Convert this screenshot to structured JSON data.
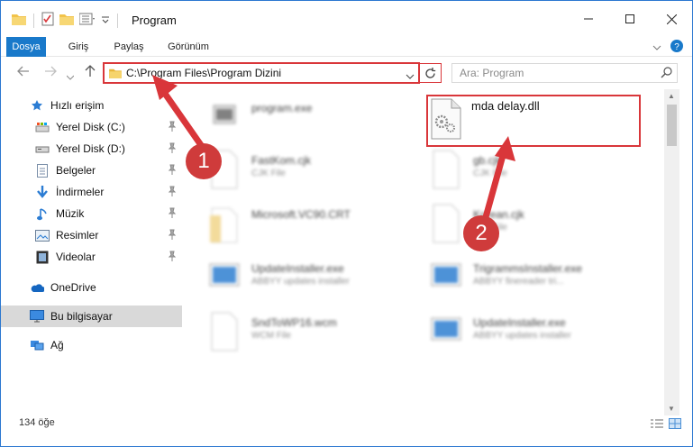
{
  "window": {
    "title": "Program"
  },
  "ribbon": {
    "tabs": [
      "Dosya",
      "Giriş",
      "Paylaş",
      "Görünüm"
    ]
  },
  "address": {
    "path": "C:\\Program Files\\Program Dizini"
  },
  "search": {
    "placeholder": "Ara: Program"
  },
  "sidebar": {
    "items": [
      {
        "label": "Hızlı erişim"
      },
      {
        "label": "Yerel Disk (C:)"
      },
      {
        "label": "Yerel Disk (D:)"
      },
      {
        "label": "Belgeler"
      },
      {
        "label": "İndirmeler"
      },
      {
        "label": "Müzik"
      },
      {
        "label": "Resimler"
      },
      {
        "label": "Videolar"
      },
      {
        "label": "OneDrive"
      },
      {
        "label": "Bu bilgisayar"
      },
      {
        "label": "Ağ"
      }
    ]
  },
  "files": {
    "program": {
      "name": "program.exe"
    },
    "dll": {
      "name": "mda delay.dll"
    },
    "fastkom": {
      "name": "FastKom.cjk",
      "sub": "CJK File"
    },
    "gb": {
      "name": "gb.cjk",
      "sub": "CJK File"
    },
    "msvc": {
      "name": "Microsoft.VC90.CRT"
    },
    "korean": {
      "name": "Korean.cjk",
      "sub": "CJK File"
    },
    "upd": {
      "name": "UpdateInstaller.exe",
      "sub": "ABBYY updates installer"
    },
    "trig": {
      "name": "TrigrammsInstaller.exe",
      "sub": "ABBYY finereader tri..."
    },
    "snd": {
      "name": "SndToWP16.wcm",
      "sub": "WCM File"
    },
    "upd2": {
      "name": "UpdateInstaller.exe",
      "sub": "ABBYY updates installer"
    }
  },
  "status": {
    "count": "134 öğe"
  },
  "annotations": {
    "one": "1",
    "two": "2"
  },
  "colors": {
    "accent": "#1979ca",
    "highlight": "#d9363a",
    "badge": "#cf3b3b"
  }
}
